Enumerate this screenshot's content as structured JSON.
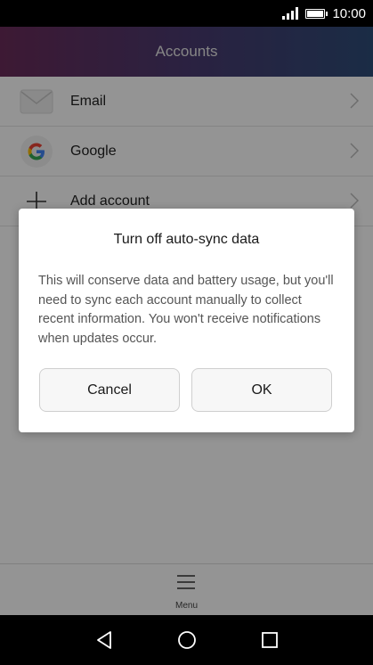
{
  "status_bar": {
    "time": "10:00",
    "signal_icon": "signal-icon",
    "battery_icon": "battery-icon"
  },
  "header": {
    "title": "Accounts"
  },
  "accounts": [
    {
      "label": "Email",
      "icon": "email-icon"
    },
    {
      "label": "Google",
      "icon": "google-icon"
    },
    {
      "label": "Add account",
      "icon": "plus-icon"
    }
  ],
  "dialog": {
    "title": "Turn off auto-sync data",
    "message": "This will conserve data and battery usage, but you'll need to sync each account manually to collect recent information. You won't receive notifications when updates occur.",
    "cancel_label": "Cancel",
    "ok_label": "OK"
  },
  "bottom_menu": {
    "label": "Menu",
    "icon": "menu-icon"
  },
  "nav": {
    "back_icon": "back-icon",
    "home_icon": "home-icon",
    "recents_icon": "recents-icon"
  },
  "colors": {
    "header_start": "#6a2c5a",
    "header_end": "#2e4c78",
    "google_blue": "#4285F4",
    "google_red": "#EA4335",
    "google_yellow": "#FBBC05",
    "google_green": "#34A853"
  }
}
